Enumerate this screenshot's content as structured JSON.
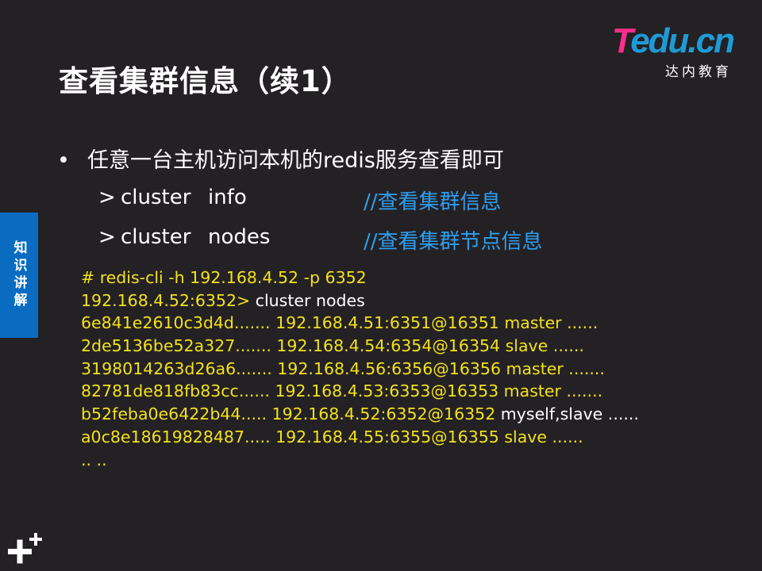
{
  "title": "查看集群信息（续1）",
  "logo": {
    "brand_t": "T",
    "brand_rest": "edu.cn",
    "subtitle": "达内教育"
  },
  "side_tab": "知识讲解",
  "bullet": {
    "dot": "•",
    "text": "任意一台主机访问本机的redis服务查看即可"
  },
  "commands": [
    {
      "prompt": ">",
      "word1": "cluster",
      "word2": "info",
      "comment": "//查看集群信息"
    },
    {
      "prompt": ">",
      "word1": "cluster",
      "word2": "nodes",
      "comment": "//查看集群节点信息"
    }
  ],
  "code_lines": [
    [
      {
        "text": "# redis-cli  -h  192.168.4.52  -p  6352",
        "color": "yellow"
      }
    ],
    [
      {
        "text": "192.168.4.52:6352> ",
        "color": "yellow"
      },
      {
        "text": "cluster  nodes",
        "color": "white"
      }
    ],
    [
      {
        "text": "6e841e2610c3d4d....... 192.168.4.51:6351@16351 master ......",
        "color": "yellow"
      }
    ],
    [
      {
        "text": "2de5136be52a327....... 192.168.4.54:6354@16354 slave ......",
        "color": "yellow"
      }
    ],
    [
      {
        "text": "3198014263d26a6....... 192.168.4.56:6356@16356 master .......",
        "color": "yellow"
      }
    ],
    [
      {
        "text": "82781de818fb83cc...... 192.168.4.53:6353@16353 master  .......",
        "color": "yellow"
      }
    ],
    [
      {
        "text": "b52feba0e6422b44..... 192.168.4.52:6352@16352 ",
        "color": "yellow"
      },
      {
        "text": "myself,slave ......",
        "color": "white"
      }
    ],
    [
      {
        "text": "a0c8e18619828487..... 192.168.4.55:6355@16355 slave ......",
        "color": "yellow"
      }
    ],
    [
      {
        "text": ".. ..",
        "color": "yellow"
      }
    ]
  ],
  "colors": {
    "background": "#242124",
    "code_yellow": "#f2e11c",
    "comment_blue": "#2d9ff0",
    "tab_blue": "#0a6cc0",
    "logo_pink": "#ff2e8c",
    "logo_blue": "#1e9bd7"
  }
}
